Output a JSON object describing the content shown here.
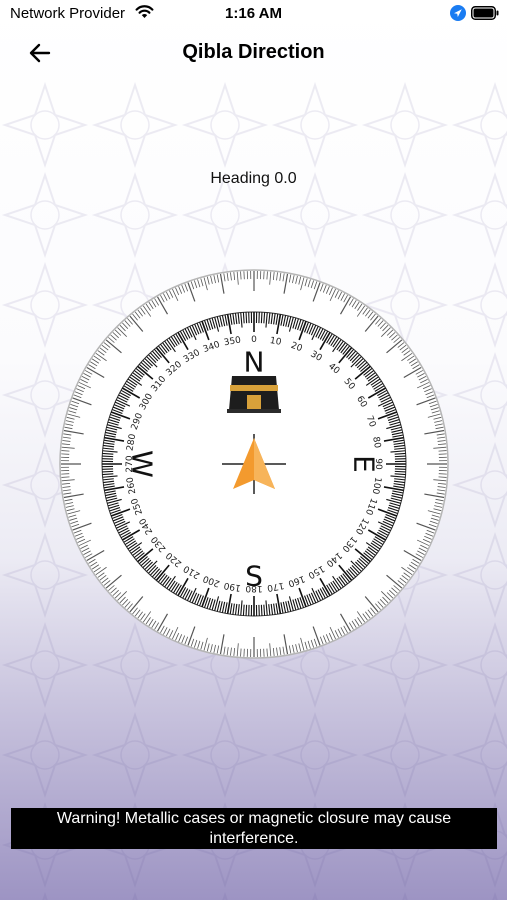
{
  "status_bar": {
    "carrier": "Network Provider",
    "time": "1:16 AM",
    "icons": [
      "wifi-icon",
      "location-arrow-icon",
      "battery-icon"
    ]
  },
  "nav": {
    "back_icon": "arrow-left-icon",
    "title": "Qibla Direction"
  },
  "heading_text": "Heading 0.0",
  "compass": {
    "cardinals": {
      "north": "N",
      "east": "E",
      "south": "S",
      "west": "W"
    },
    "degree_labels": [
      "0",
      "10",
      "20",
      "30",
      "40",
      "50",
      "60",
      "70",
      "80",
      "90",
      "100",
      "110",
      "120",
      "130",
      "140",
      "150",
      "160",
      "170",
      "180",
      "190",
      "200",
      "210",
      "220",
      "230",
      "240",
      "250",
      "260",
      "270",
      "280",
      "290",
      "300",
      "310",
      "320",
      "330",
      "340",
      "350"
    ],
    "qibla_marker_icon": "kaaba-icon",
    "direction_icon": "navigation-arrow-icon",
    "arrow_color": "#f39a2e"
  },
  "warning_text": "Warning! Metallic cases or magnetic closure may cause interference.",
  "colors": {
    "background_bottom": "#9d94c3",
    "warning_bg": "#000000"
  }
}
